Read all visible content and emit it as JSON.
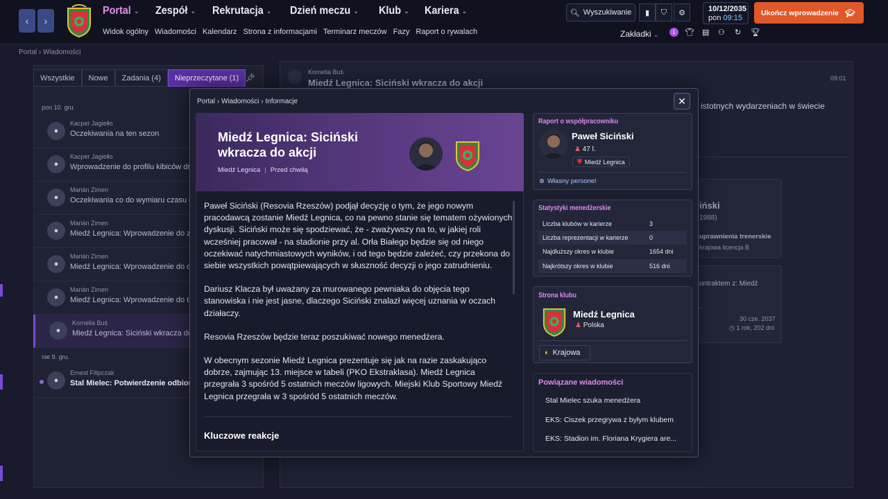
{
  "topbar": {
    "menu": [
      "Portal",
      "Zespół",
      "Rekrutacja",
      "Dzień meczu",
      "Klub",
      "Kariera"
    ],
    "submenu": [
      "Widok ogólny",
      "Wiadomości",
      "Kalendarz",
      "Strona z informacjami",
      "Terminarz meczów",
      "Fazy",
      "Raport o rywalach"
    ],
    "search_label": "Wyszukiwanie",
    "date": "10/12/2035",
    "day": "pon",
    "time": "09:15",
    "cta_label": "Ukończ wprowadzenie",
    "tabs_label": "Zakładki",
    "notif_count": "1"
  },
  "breadcrumb": {
    "a": "Portal",
    "b": "Wiadomości"
  },
  "inbox": {
    "filters": [
      "Wszystkie",
      "Nowe",
      "Zadania (4)",
      "Nieprzeczytane (1)"
    ],
    "days": [
      "pon 10. gru.",
      "nie 9. gru."
    ],
    "messages": [
      {
        "sender": "Kacper Jagiełło",
        "subject": "Oczekiwania na ten sezon"
      },
      {
        "sender": "Kacper Jagiełło",
        "subject": "Wprowadzenie do profilu kibiców drużyny"
      },
      {
        "sender": "Marián Zimen",
        "subject": "Oczekiwania co do wymiaru czasu gry"
      },
      {
        "sender": "Marián Zimen",
        "subject": "Miedź Legnica: Wprowadzenie do zespołu"
      },
      {
        "sender": "Marián Zimen",
        "subject": "Miedź Legnica: Wprowadzenie do obiektów"
      },
      {
        "sender": "Marián Zimen",
        "subject": "Miedź Legnica: Wprowadzenie do taktyki"
      },
      {
        "sender": "Kornelia Buś",
        "subject": "Miedź Legnica: Siciński wkracza do akcji"
      },
      {
        "sender": "Ernest Filipczak",
        "subject": "Stal Mielec: Potwierdzenie odbioru"
      }
    ]
  },
  "reading": {
    "sender": "Kornelia Buś",
    "subject": "Miedź Legnica: Siciński wkracza do akcji",
    "time": "09:01",
    "body_fragment": "istotnych wydarzeniach w świecie",
    "side1_name": "iński",
    "side1_year": "1988)",
    "side1_l1": "uprawnienia trenerskie",
    "side1_l2": "krajowa licencja B",
    "side2_l1": "ontraktem z: Miedź",
    "side2_date": "30 cze. 2037",
    "side2_dur": "1 rok, 202 dni"
  },
  "modal": {
    "crumb": [
      "Portal",
      "Wiadomości",
      "Informacje"
    ],
    "title": "Miedź Legnica: Siciński wkracza do akcji",
    "club": "Miedź Legnica",
    "when": "Przed chwilą",
    "paragraphs": [
      "Paweł Siciński (Resovia Rzeszów) podjął decyzję o tym, że jego nowym pracodawcą zostanie Miedź Legnica, co na pewno stanie się tematem ożywionych dyskusji. Siciński może się spodziewać, że - zważywszy na to, w jakiej roli wcześniej pracował - na stadionie przy al. Orła Białego będzie się od niego oczekiwać natychmiastowych wyników, i od tego będzie zależeć, czy przekona do siebie wszystkich powątpiewających w słuszność decyzji o jego zatrudnieniu.",
      "Dariusz Klacza był uważany za murowanego pewniaka do objęcia tego stanowiska i nie jest jasne, dlaczego Siciński znalazł więcej uznania w oczach działaczy.",
      "Resovia Rzeszów będzie teraz poszukiwać nowego menedżera.",
      "W obecnym sezonie Miedź Legnica prezentuje się jak na razie zaskakująco dobrze, zajmując 13. miejsce w tabeli (PKO Ekstraklasa). Miedź Legnica przegrała 3 spośród 5 ostatnich meczów ligowych. Miejski Klub Sportowy Miedź Legnica przegrała w 3 spośród 5 ostatnich meczów."
    ],
    "section_heading": "Kluczowe reakcje"
  },
  "staff_report": {
    "title": "Raport o współpracowniku",
    "name": "Paweł Siciński",
    "age": "47 l.",
    "club": "Miedź Legnica",
    "link": "Własny personel"
  },
  "manager_stats": {
    "title": "Statystyki menedżerskie",
    "rows": [
      {
        "label": "Liczba klubów w karierze",
        "value": "3"
      },
      {
        "label": "Liczba reprezentacji w karierze",
        "value": "0"
      },
      {
        "label": "Najdłuższy okres w klubie",
        "value": "1654 dni"
      },
      {
        "label": "Najkrótszy okres w klubie",
        "value": "516 dni"
      }
    ]
  },
  "club_page": {
    "title": "Strona klubu",
    "name": "Miedź Legnica",
    "nation": "Polska",
    "tag": "Krajowa"
  },
  "related": {
    "title": "Powiązane wiadomości",
    "items": [
      "Stal Mielec szuka menedżera",
      "EKS: Ciszek przegrywa z byłym klubem",
      "EKS: Stadion im. Floriana Krygiera are..."
    ]
  },
  "colors": {
    "accent": "#e088f0",
    "cta": "#e0572a",
    "selected": "#5a30a0"
  }
}
